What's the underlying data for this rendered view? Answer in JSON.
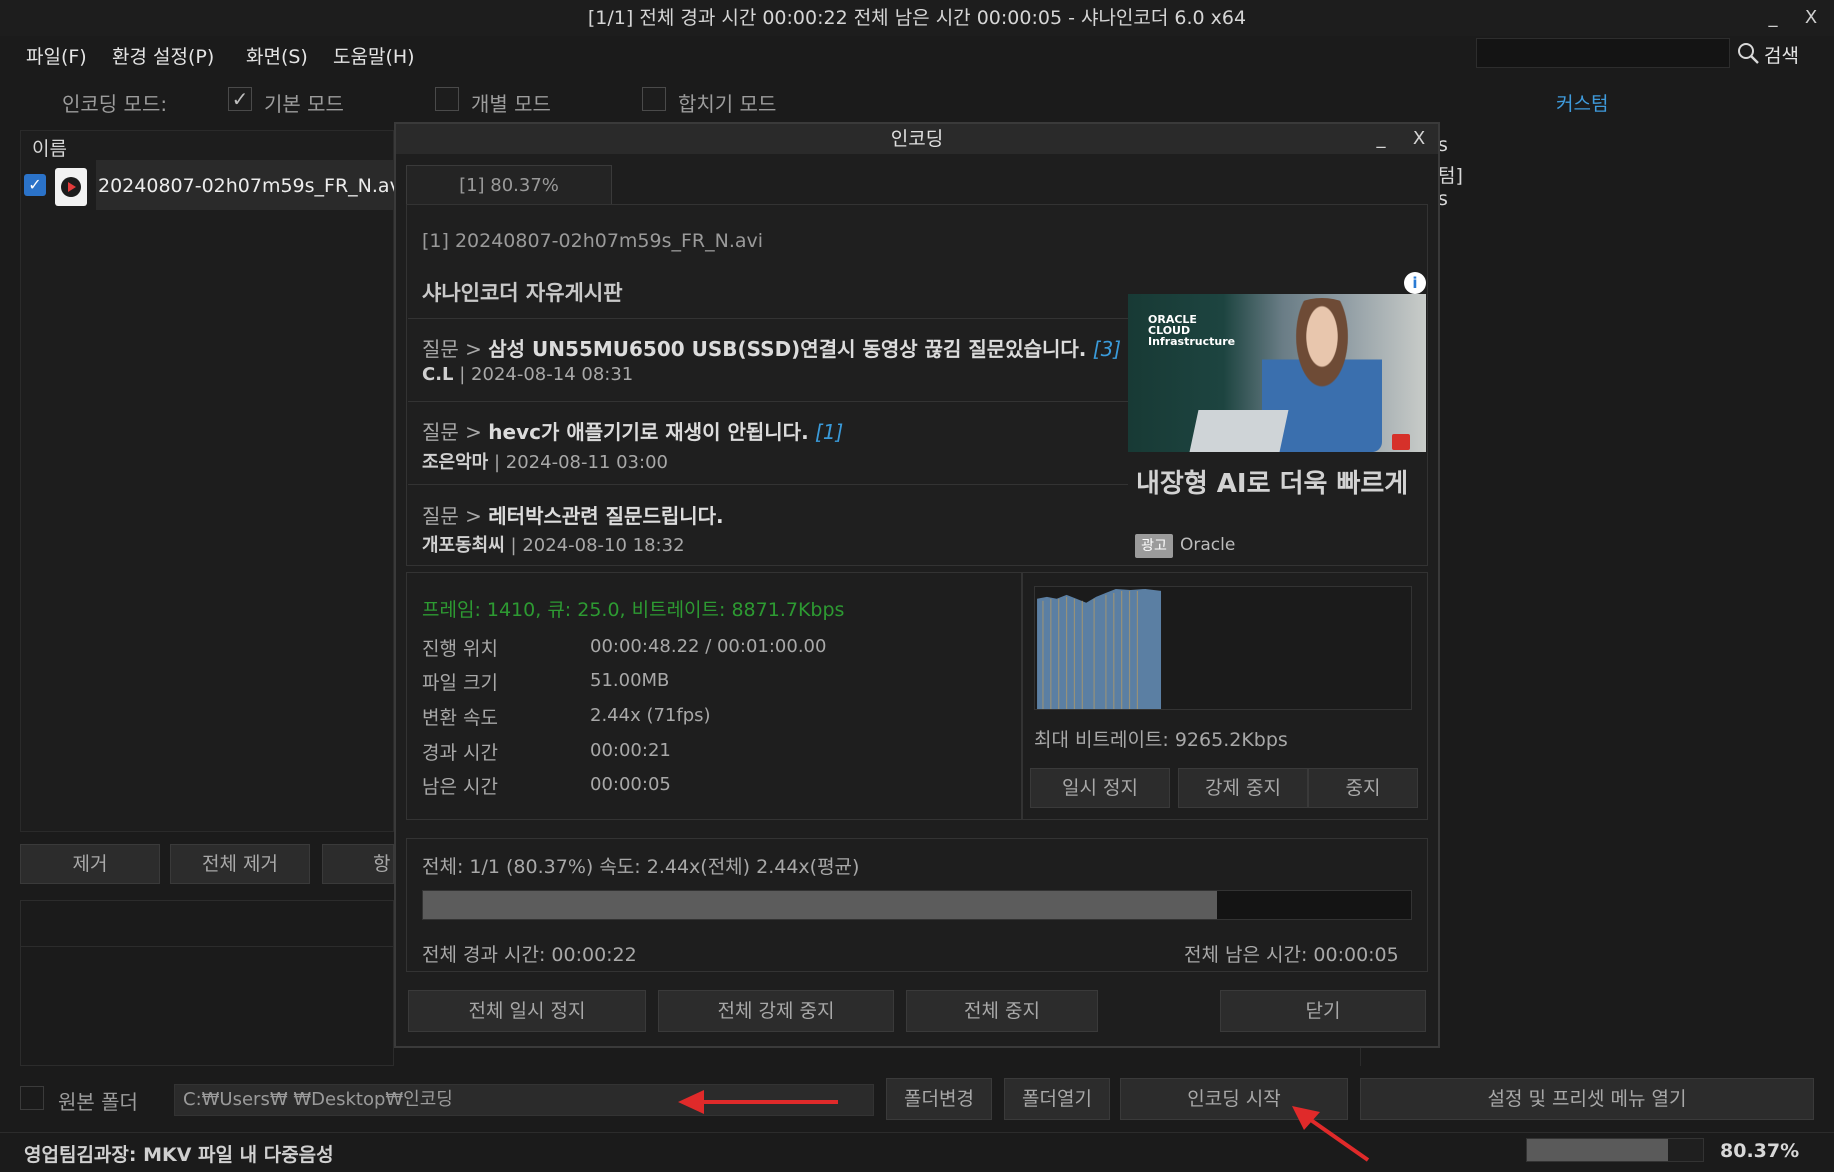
{
  "window": {
    "title": "[1/1] 전체 경과 시간 00:00:22 전체 남은 시간 00:00:05 - 샤나인코더 6.0 x64",
    "minimize": "_",
    "close": "X"
  },
  "menu": {
    "file": "파일(F)",
    "settings": "환경 설정(P)",
    "view": "화면(S)",
    "help": "도움말(H)"
  },
  "search": {
    "label": "검색",
    "value": ""
  },
  "mode": {
    "label": "인코딩 모드:",
    "basic": "기본 모드",
    "basic_checked": true,
    "individual": "개별 모드",
    "individual_checked": false,
    "merge": "합치기 모드",
    "merge_checked": false,
    "custom": "커스텀"
  },
  "file_list": {
    "header": "이름",
    "items": [
      {
        "name": "20240807-02h07m59s_FR_N.avi",
        "checked": true
      }
    ]
  },
  "list_buttons": {
    "remove": "제거",
    "remove_all": "전체 제거",
    "item": "항"
  },
  "right_panel": {
    "line1": "s",
    "line2": "텀]",
    "line3": "s"
  },
  "output": {
    "source_folder_label": "원본 폴더",
    "source_folder_checked": false,
    "path": "C:₩Users₩        ₩Desktop₩인코딩",
    "change_folder": "폴더변경",
    "open_folder": "폴더열기",
    "start_encoding": "인코딩 시작",
    "open_settings": "설정 및 프리셋 메뉴 열기"
  },
  "status": {
    "text": "영업팀김과장: MKV 파일 내 다중음성",
    "percent": "80.37%",
    "progress": 0.8037
  },
  "dialog": {
    "title": "인코딩",
    "minimize": "_",
    "close": "X",
    "tab": "[1] 80.37%",
    "file": "[1] 20240807-02h07m59s_FR_N.avi",
    "board_title": "샤나인코더 자유게시판",
    "posts": [
      {
        "prefix": "질문 > ",
        "title": "삼성 UN55MU6500 USB(SSD)연결시 동영상 끊김 질문있습니다.",
        "count": "[3]",
        "author": "C.L",
        "date": "2024-08-14 08:31"
      },
      {
        "prefix": "질문 > ",
        "title": "hevc가 애플기기로 재생이 안됩니다.",
        "count": "[1]",
        "author": "조은악마",
        "date": "2024-08-11 03:00"
      },
      {
        "prefix": "질문 > ",
        "title": "레터박스관련 질문드립니다.",
        "count": "",
        "author": "개포동최씨",
        "date": "2024-08-10 18:32"
      }
    ],
    "ad": {
      "logo": "ORACLE CLOUD Infrastructure",
      "info": "i",
      "headline": "내장형 AI로 더욱 빠르게",
      "badge": "광고",
      "brand": "Oracle"
    },
    "frame_line": "프레임: 1410, 큐: 25.0, 비트레이트: 8871.7Kbps",
    "stats": [
      {
        "label": "진행 위치",
        "value": "00:00:48.22 / 00:01:00.00"
      },
      {
        "label": "파일 크기",
        "value": "51.00MB"
      },
      {
        "label": "변환 속도",
        "value": "2.44x (71fps)"
      },
      {
        "label": "경과 시간",
        "value": "00:00:21"
      },
      {
        "label": "남은 시간",
        "value": "00:00:05"
      }
    ],
    "max_bitrate": "최대 비트레이트: 9265.2Kbps",
    "pause": "일시 정지",
    "force_stop": "강제 중지",
    "stop": "중지",
    "total_line": "전체: 1/1 (80.37%) 속도: 2.44x(전체) 2.44x(평균)",
    "total_progress": 0.8037,
    "total_elapsed": "전체 경과 시간: 00:00:22",
    "total_remaining": "전체 남은 시간: 00:00:05",
    "pause_all": "전체 일시 정지",
    "force_stop_all": "전체 강제 중지",
    "stop_all": "전체 중지",
    "close_button": "닫기"
  },
  "colors": {
    "accent": "#3f9bdc",
    "frame_green": "#2d9a32",
    "arrow_red": "#e02a2a",
    "graph_blue": "#5b7fa3"
  }
}
